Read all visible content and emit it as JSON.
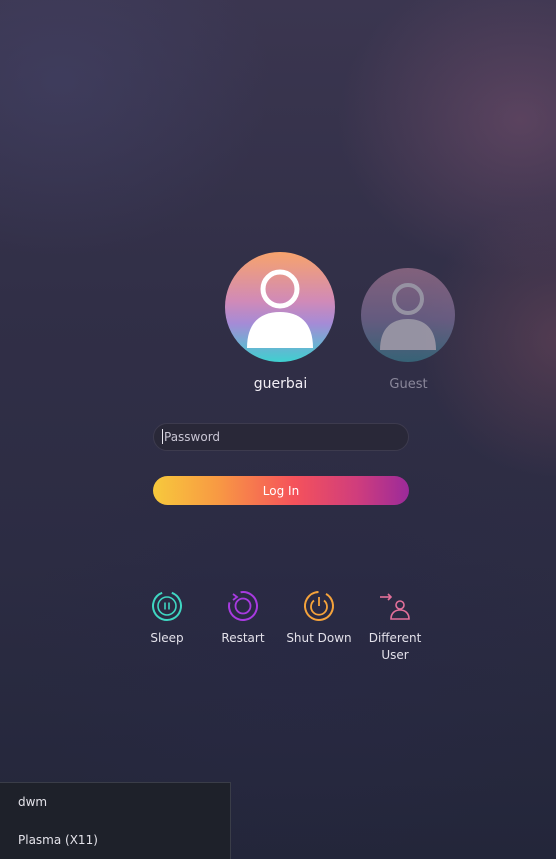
{
  "users": [
    {
      "name": "guerbai",
      "selected": true
    },
    {
      "name": "Guest",
      "selected": false
    }
  ],
  "login": {
    "password_placeholder": "Password",
    "login_label": "Log In"
  },
  "actions": {
    "sleep": "Sleep",
    "restart": "Restart",
    "shutdown": "Shut Down",
    "different_user": "Different\nUser"
  },
  "sessions": [
    "dwm",
    "Plasma (X11)"
  ],
  "colors": {
    "login_gradient": [
      "#f7c93c",
      "#f5525b",
      "#9b2a9a"
    ],
    "sleep_icon": "#3fd6c2",
    "restart_icon": "#a83ae0",
    "shutdown_icon": "#f5a33b",
    "different_user_icon": "#e4709a"
  }
}
